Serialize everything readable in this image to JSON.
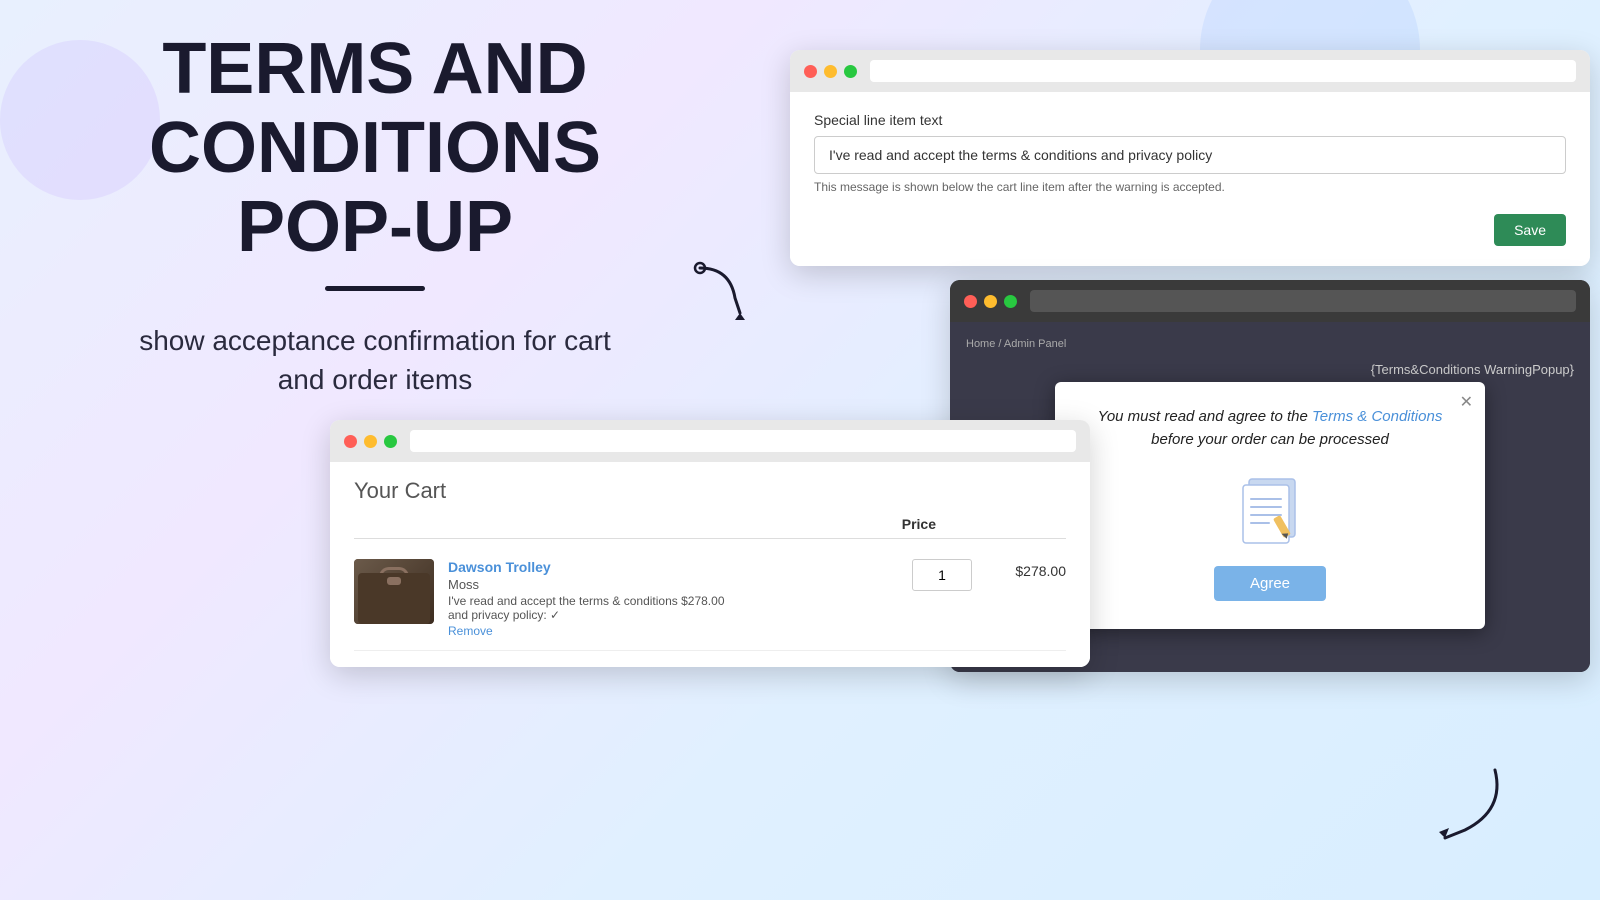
{
  "page": {
    "title": "Terms and Conditions Pop-Up"
  },
  "hero": {
    "line1": "TERMS AND",
    "line2": "CONDITIONS",
    "line3": "POP-UP",
    "subtitle": "show acceptance confirmation for cart\nand order items"
  },
  "top_window": {
    "field_label": "Special line item text",
    "input_value": "I've read and accept the terms & conditions and privacy policy",
    "field_hint": "This message is shown below the cart line item after the warning is accepted.",
    "save_button": "Save"
  },
  "modal_window": {
    "breadcrumb": "Home / Admin Panel",
    "page_label": "{Terms&Conditions WarningPopup}",
    "modal_text_before": "You must read and agree to the ",
    "modal_link": "Terms & Conditions",
    "modal_text_after": " before your order can be processed",
    "close_symbol": "✕",
    "agree_button": "Agree"
  },
  "cart_window": {
    "title": "Your Cart",
    "price_header": "Price",
    "item": {
      "name": "Dawson Trolley",
      "variant": "Moss",
      "terms_line": "I've read and accept the terms & conditions",
      "price_inline": "$278.00",
      "privacy_line": "and privacy policy: ✓",
      "remove_label": "Remove",
      "quantity": "1",
      "price": "$278.00"
    }
  }
}
